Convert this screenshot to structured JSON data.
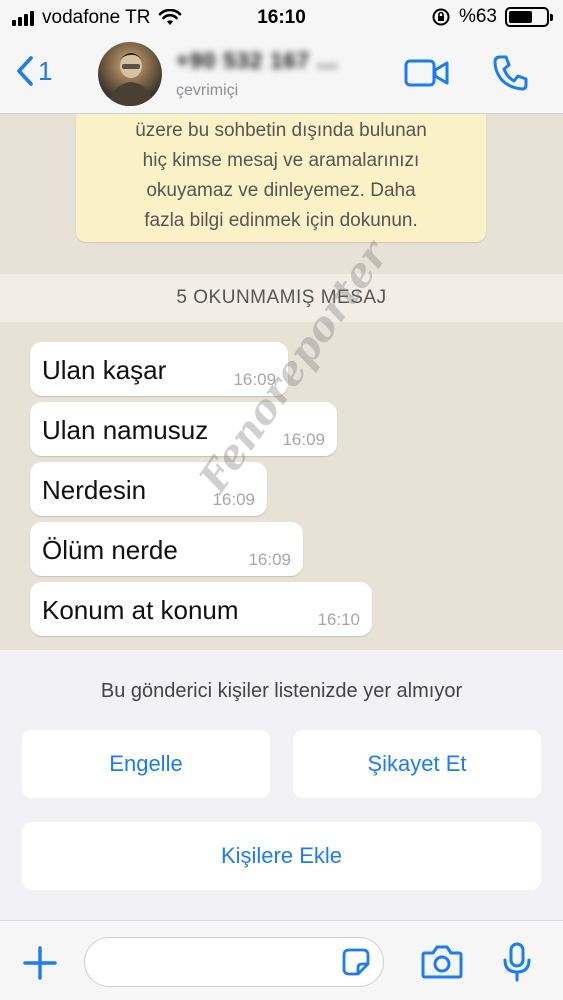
{
  "status_bar": {
    "carrier": "vodafone TR",
    "time": "16:10",
    "battery": "%63",
    "battery_level": 0.63
  },
  "header": {
    "back_count": "1",
    "contact_name": "+90 532 167 ...",
    "contact_status": "çevrimiçi"
  },
  "chat": {
    "encryption_notice": [
      "üzere bu sohbetin dışında bulunan",
      "hiç kimse mesaj ve aramalarınızı",
      "okuyamaz ve dinleyemez. Daha",
      "fazla bilgi edinmek için dokunun."
    ],
    "unread_banner": "5 OKUNMAMIŞ MESAJ",
    "messages": [
      {
        "text": "Ulan kaşar",
        "time": "16:09"
      },
      {
        "text": "Ulan namusuz",
        "time": "16:09"
      },
      {
        "text": "Nerdesin",
        "time": "16:09"
      },
      {
        "text": "Ölüm nerde",
        "time": "16:09"
      },
      {
        "text": "Konum at konum",
        "time": "16:10"
      }
    ],
    "watermark": "Fenoreporter"
  },
  "block_panel": {
    "title": "Bu gönderici kişiler listenizde yer almıyor",
    "block_label": "Engelle",
    "report_label": "Şikayet Et",
    "add_contact_label": "Kişilere Ekle"
  },
  "input_bar": {
    "placeholder": ""
  },
  "colors": {
    "accent": "#1b7cf5",
    "notice_bg": "#fbf1c6",
    "chat_bg": "#e8e1d6",
    "bubble_bg": "#ffffff"
  }
}
